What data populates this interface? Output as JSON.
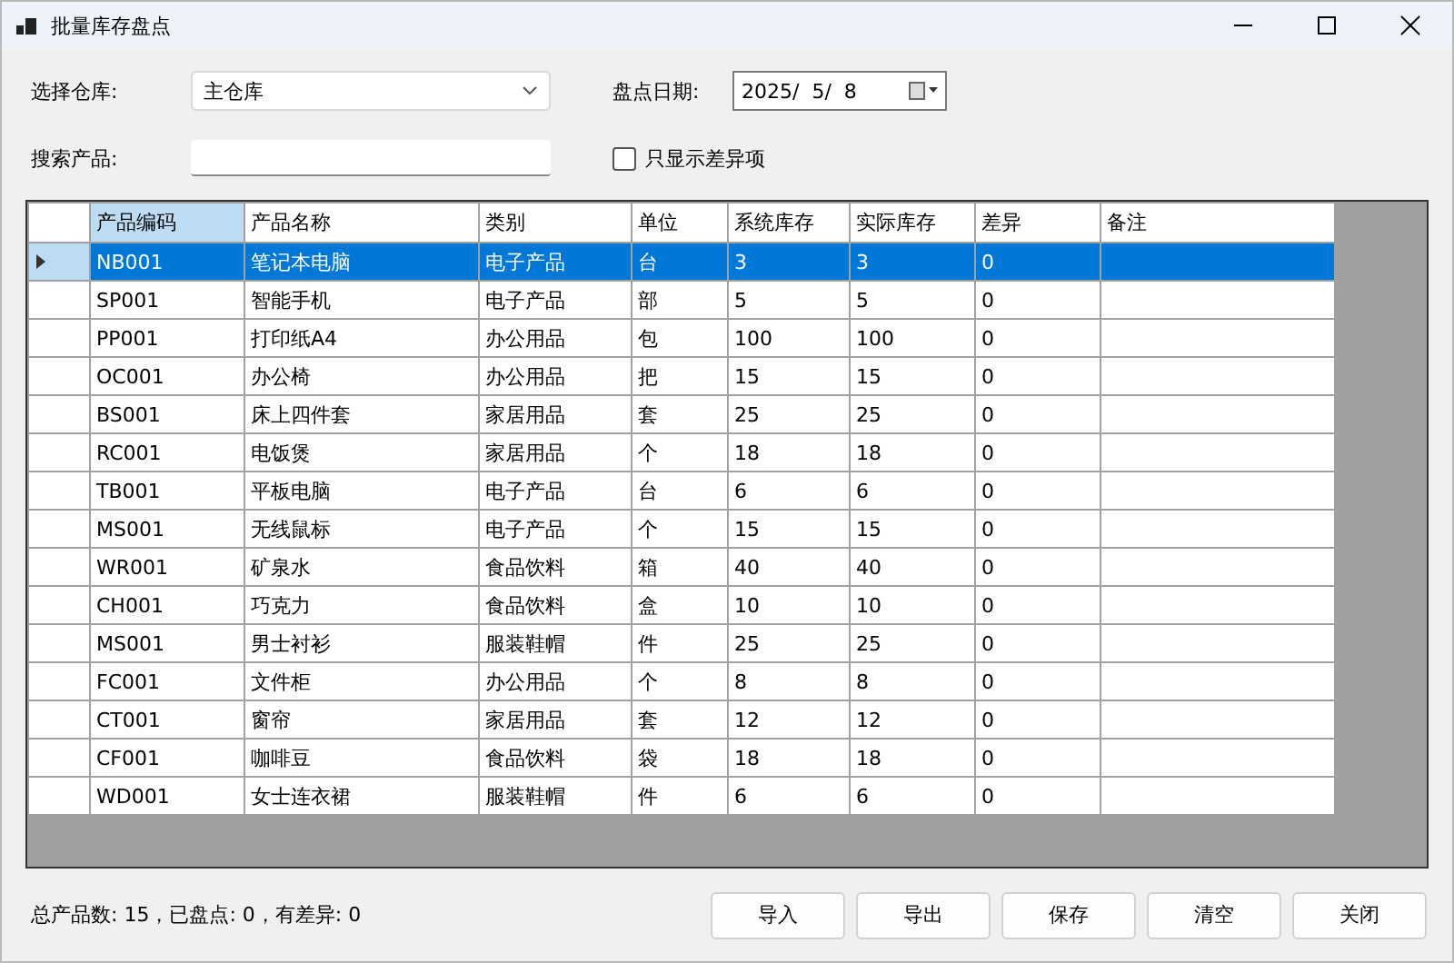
{
  "window": {
    "title": "批量库存盘点"
  },
  "form": {
    "warehouse_label": "选择仓库:",
    "warehouse": "主仓库",
    "date_label": "盘点日期:",
    "date": "2025/  5/  8",
    "search_label": "搜索产品:",
    "diff_only": {
      "label": "只显示差异项",
      "checked": false
    }
  },
  "table": {
    "columns": [
      "产品编码",
      "产品名称",
      "类别",
      "单位",
      "系统库存",
      "实际库存",
      "差异",
      "备注"
    ],
    "rows": [
      {
        "cells": [
          "NB001",
          "笔记本电脑",
          "电子产品",
          "台",
          "3",
          "3",
          "0"
        ],
        "selected": true
      },
      {
        "cells": [
          "SP001",
          "智能手机",
          "电子产品",
          "部",
          "5",
          "5",
          "0"
        ],
        "selected": false
      },
      {
        "cells": [
          "PP001",
          "打印纸A4",
          "办公用品",
          "包",
          "100",
          "100",
          "0"
        ],
        "selected": false
      },
      {
        "cells": [
          "OC001",
          "办公椅",
          "办公用品",
          "把",
          "15",
          "15",
          "0"
        ],
        "selected": false
      },
      {
        "cells": [
          "BS001",
          "床上四件套",
          "家居用品",
          "套",
          "25",
          "25",
          "0"
        ],
        "selected": false
      },
      {
        "cells": [
          "RC001",
          "电饭煲",
          "家居用品",
          "个",
          "18",
          "18",
          "0"
        ],
        "selected": false
      },
      {
        "cells": [
          "TB001",
          "平板电脑",
          "电子产品",
          "台",
          "6",
          "6",
          "0"
        ],
        "selected": false
      },
      {
        "cells": [
          "MS001",
          "无线鼠标",
          "电子产品",
          "个",
          "15",
          "15",
          "0"
        ],
        "selected": false
      },
      {
        "cells": [
          "WR001",
          "矿泉水",
          "食品饮料",
          "箱",
          "40",
          "40",
          "0"
        ],
        "selected": false
      },
      {
        "cells": [
          "CH001",
          "巧克力",
          "食品饮料",
          "盒",
          "10",
          "10",
          "0"
        ],
        "selected": false
      },
      {
        "cells": [
          "MS001",
          "男士衬衫",
          "服装鞋帽",
          "件",
          "25",
          "25",
          "0"
        ],
        "selected": false
      },
      {
        "cells": [
          "FC001",
          "文件柜",
          "办公用品",
          "个",
          "8",
          "8",
          "0"
        ],
        "selected": false
      },
      {
        "cells": [
          "CT001",
          "窗帘",
          "家居用品",
          "套",
          "12",
          "12",
          "0"
        ],
        "selected": false
      },
      {
        "cells": [
          "CF001",
          "咖啡豆",
          "食品饮料",
          "袋",
          "18",
          "18",
          "0"
        ],
        "selected": false
      },
      {
        "cells": [
          "WD001",
          "女士连衣裙",
          "服装鞋帽",
          "件",
          "6",
          "6",
          "0"
        ],
        "selected": false
      }
    ]
  },
  "status_bar": "总产品数: 15，已盘点: 0，有差异: 0",
  "buttons": [
    "导入",
    "导出",
    "保存",
    "清空",
    "关闭"
  ]
}
